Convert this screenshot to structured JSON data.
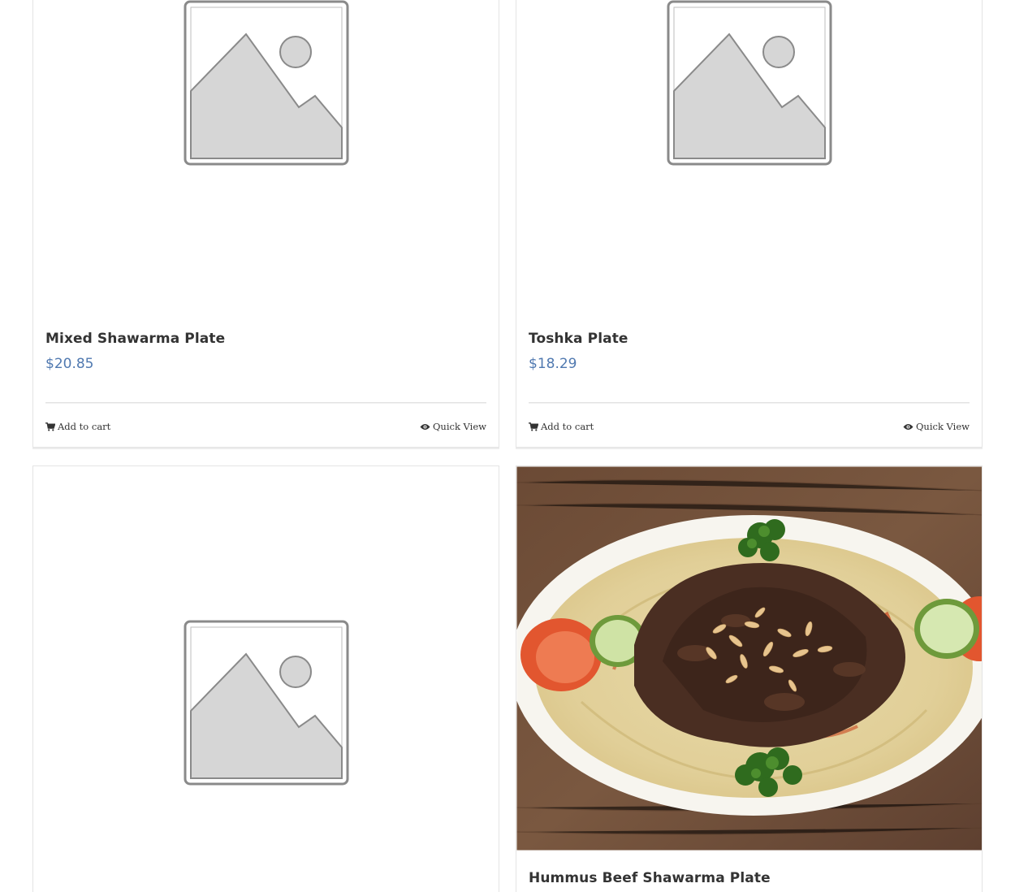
{
  "products": [
    {
      "title": "Mixed Shawarma Plate",
      "price": "$20.85",
      "add_to_cart": "Add to cart",
      "quick_view": "Quick View",
      "image": "placeholder-image"
    },
    {
      "title": "Toshka Plate",
      "price": "$18.29",
      "add_to_cart": "Add to cart",
      "quick_view": "Quick View",
      "image": "placeholder-image"
    },
    {
      "title": "",
      "image": "placeholder-image"
    },
    {
      "title": "Hummus Beef Shawarma Plate",
      "image": "hummus-beef-shawarma-photo"
    }
  ],
  "colors": {
    "price": "#5079b0",
    "title": "#333333",
    "border": "#e4e4e4"
  }
}
